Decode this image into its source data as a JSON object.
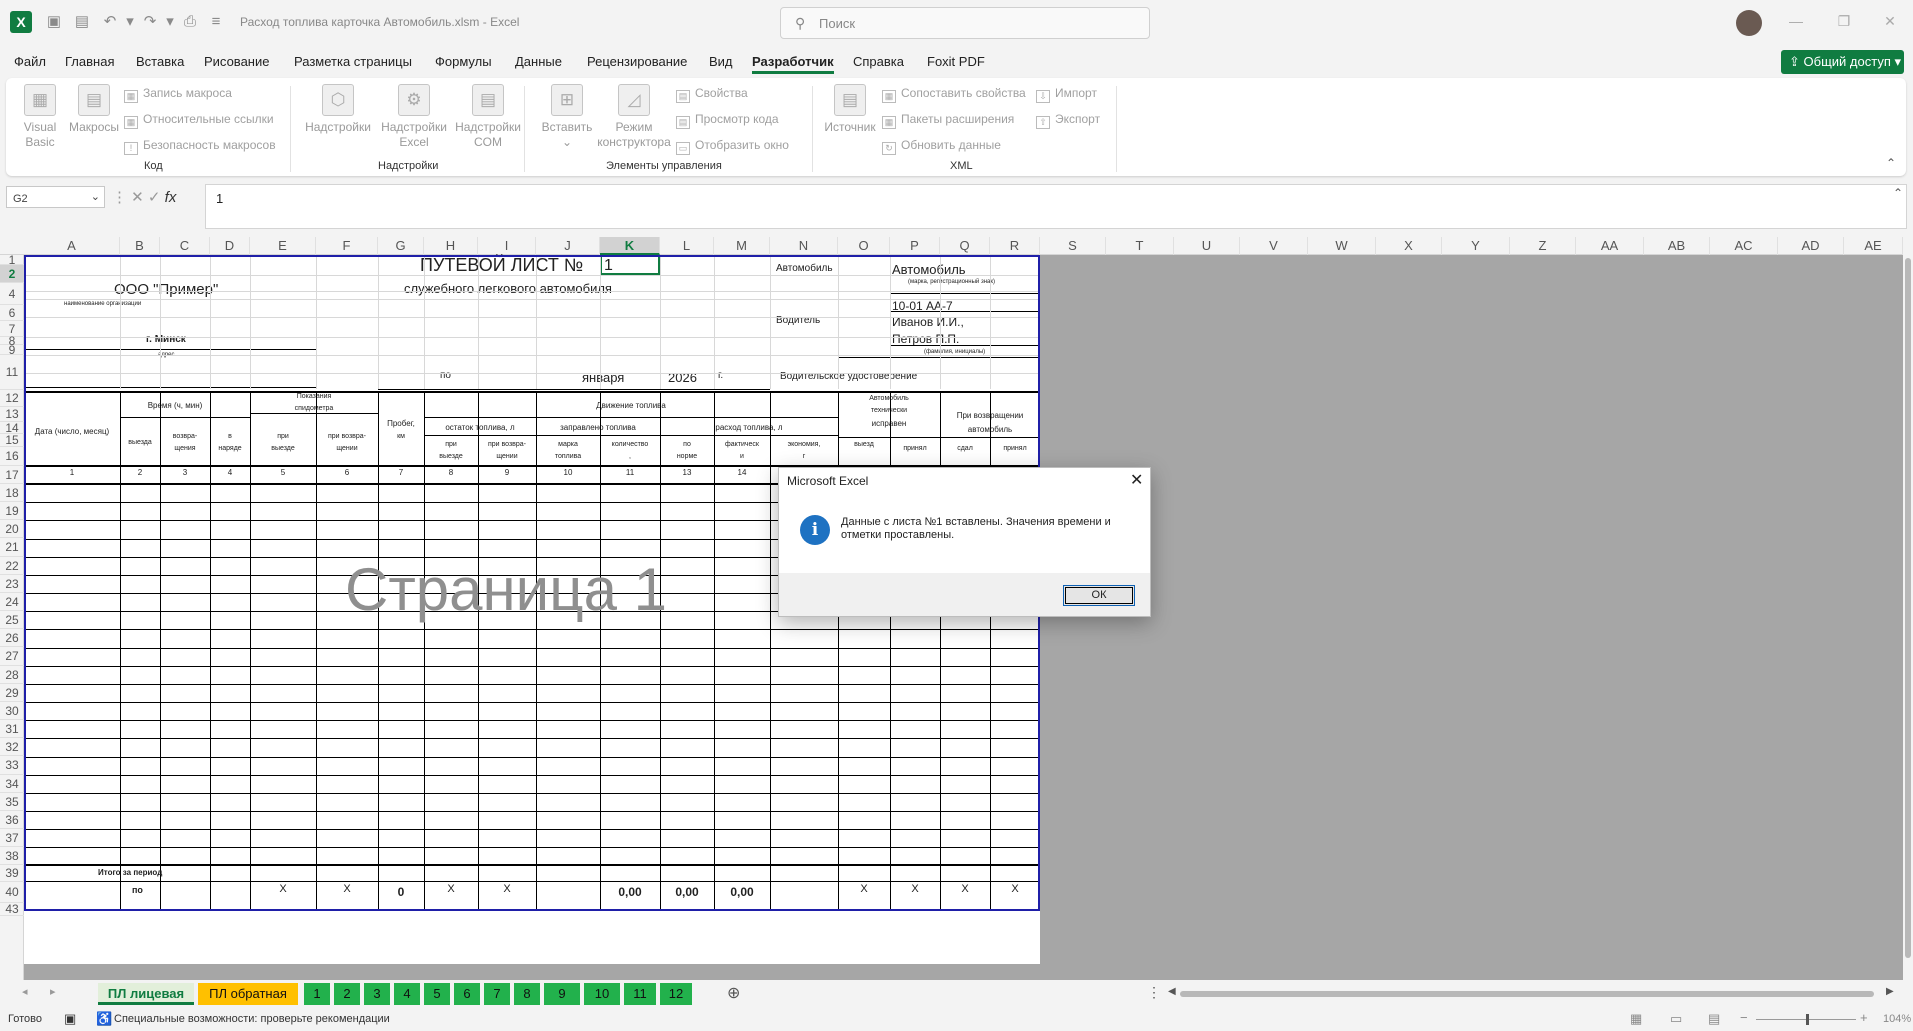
{
  "title": {
    "doc": "Расход топлива карточка Автомобиль.xlsm  -  Excel",
    "search": "Поиск"
  },
  "menu": [
    "Файл",
    "Главная",
    "Вставка",
    "Рисование",
    "Разметка страницы",
    "Формулы",
    "Данные",
    "Рецензирование",
    "Вид",
    "Разработчик",
    "Справка",
    "Foxit PDF"
  ],
  "share": "Общий доступ",
  "ribbon": {
    "code": {
      "vb1": "Visual",
      "vb2": "Basic",
      "macros": "Макросы",
      "record": "Запись макроса",
      "relative": "Относительные ссылки",
      "security": "Безопасность макросов",
      "label": "Код"
    },
    "addins": {
      "a1": "Надстройки",
      "b1": "Надстройки",
      "b2": "Excel",
      "c1": "Надстройки",
      "c2": "COM",
      "label": "Надстройки"
    },
    "controls": {
      "insert": "Вставить",
      "mode1": "Режим",
      "mode2": "конструктора",
      "props": "Свойства",
      "code": "Просмотр кода",
      "window": "Отобразить окно",
      "label": "Элементы управления"
    },
    "xml": {
      "source": "Источник",
      "map": "Сопоставить свойства",
      "packs": "Пакеты расширения",
      "refresh": "Обновить данные",
      "import": "Импорт",
      "export": "Экспорт",
      "label": "XML"
    }
  },
  "namebox": "G2",
  "formula": "1",
  "columns": [
    "A",
    "B",
    "C",
    "D",
    "E",
    "F",
    "G",
    "H",
    "I",
    "J",
    "K",
    "L",
    "M",
    "N",
    "O",
    "P",
    "Q",
    "R",
    "S",
    "T",
    "U",
    "V",
    "W",
    "X",
    "Y",
    "Z",
    "AA",
    "AB",
    "AC",
    "AD",
    "AE"
  ],
  "rows": [
    "1",
    "2",
    "4",
    "6",
    "7",
    "8",
    "9",
    "11",
    "12",
    "13",
    "14",
    "15",
    "16",
    "17",
    "18",
    "19",
    "20",
    "21",
    "22",
    "23",
    "24",
    "25",
    "26",
    "27",
    "28",
    "29",
    "30",
    "31",
    "32",
    "33",
    "34",
    "35",
    "36",
    "37",
    "38",
    "39",
    "40",
    "43"
  ],
  "sheet": {
    "title": "ПУТЕВОЙ ЛИСТ №",
    "number": "1",
    "subtitle": "служебного легкового автомобиля",
    "org": "ООО \"Пример\"",
    "org_caption": "наименование организации",
    "city": "г. Минск",
    "city_caption": "адрес",
    "car_label": "Автомобиль",
    "car_value": "Автомобиль",
    "car_caption": "(марка, регистрационный знак)",
    "plate": "10-01 АА-7",
    "driver_label": "Водитель",
    "driver1": "Иванов И.И.,",
    "driver2": "Петров П.П.",
    "driver_caption": "(фамилия, инициалы)",
    "po": "по",
    "month": "января",
    "year": "2026",
    "g": "г.",
    "license": "Водительское удостоверение",
    "h_date": "Дата (число, месяц)",
    "h_time": "Время (ч, мин)",
    "h_vyezda": "выезда",
    "h_vozvr1": "возвра-",
    "h_vozvr2": "щения",
    "h_nar1": "в",
    "h_nar2": "наряде",
    "h_spd1": "Показания",
    "h_spd2": "спидометра",
    "h_pv1": "при",
    "h_pv2": "выезде",
    "h_pr1": "при возвра-",
    "h_pr2": "щении",
    "h_run1": "Пробег,",
    "h_run2": "км",
    "h_fuel": "Движение топлива",
    "h_rest": "остаток топлива, л",
    "h_filled": "заправлено топлива",
    "h_used": "расход топлива, л",
    "h_rv1": "при",
    "h_rv2": "выезде",
    "h_rr1": "при возвра-",
    "h_rr2": "щении",
    "h_brand1": "марка",
    "h_brand2": "топлива",
    "h_qty1": "количество",
    "h_qty2": ",",
    "h_norm1": "по",
    "h_norm2": "норме",
    "h_fact1": "фактическ",
    "h_fact2": "и",
    "h_econ1": "экономия,",
    "h_econ2": "г",
    "h_tech1": "Автомобиль",
    "h_tech2": "технически",
    "h_tech3": "исправен",
    "h_back1": "При возвращении",
    "h_back2": "автомобиль",
    "h_t_out": "выезд",
    "h_t_acc": "принял",
    "h_b_gave": "сдал",
    "h_b_acc": "принял",
    "nums": [
      "1",
      "2",
      "3",
      "4",
      "5",
      "6",
      "7",
      "8",
      "9",
      "10",
      "11",
      "13",
      "14"
    ],
    "total": "Итого за период",
    "total_po": "по",
    "x": "X",
    "run_total": "0",
    "qty_total": "0,00",
    "norm_total": "0,00",
    "fact_total": "0,00"
  },
  "watermark": "Страница 1",
  "tabs": [
    "ПЛ лицевая",
    "ПЛ обратная",
    "1",
    "2",
    "3",
    "4",
    "5",
    "6",
    "7",
    "8",
    "9",
    "10",
    "11",
    "12"
  ],
  "status": {
    "ready": "Готово",
    "access": "Специальные возможности: проверьте рекомендации",
    "zoom": "104%"
  },
  "dialog": {
    "title": "Microsoft Excel",
    "message": "Данные с листа №1 вставлены. Значения времени и отметки проставлены.",
    "ok": "ОК"
  },
  "colors": {
    "accent": "#107c41",
    "tab_active": "#e2efda",
    "tab_yellow": "#ffc000",
    "tab_green": "#22b14c",
    "border_blue": "#1f1fa8"
  }
}
